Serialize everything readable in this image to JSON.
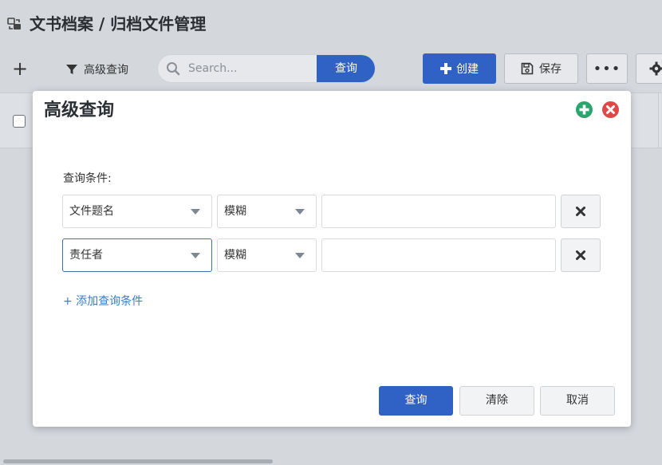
{
  "header": {
    "title": "文书档案 / 归档文件管理",
    "icon": "folder-link-icon"
  },
  "toolbar": {
    "add_label": "+",
    "advanced_label": "高级查询",
    "search_placeholder": "Search...",
    "search_button": "查询",
    "create_label": "创建",
    "save_label": "保存",
    "more_label": "•••"
  },
  "modal": {
    "title": "高级查询",
    "condition_label": "查询条件:",
    "conditions": [
      {
        "field": "文件题名",
        "operator": "模糊",
        "value": ""
      },
      {
        "field": "责任者",
        "operator": "模糊",
        "value": ""
      }
    ],
    "add_condition_label": "+ 添加查询条件",
    "buttons": {
      "query": "查询",
      "clear": "清除",
      "cancel": "取消"
    }
  },
  "colors": {
    "primary": "#2f62c4",
    "link": "#3a7bc8",
    "add_green": "#2aa56b",
    "close_red": "#e04848"
  }
}
